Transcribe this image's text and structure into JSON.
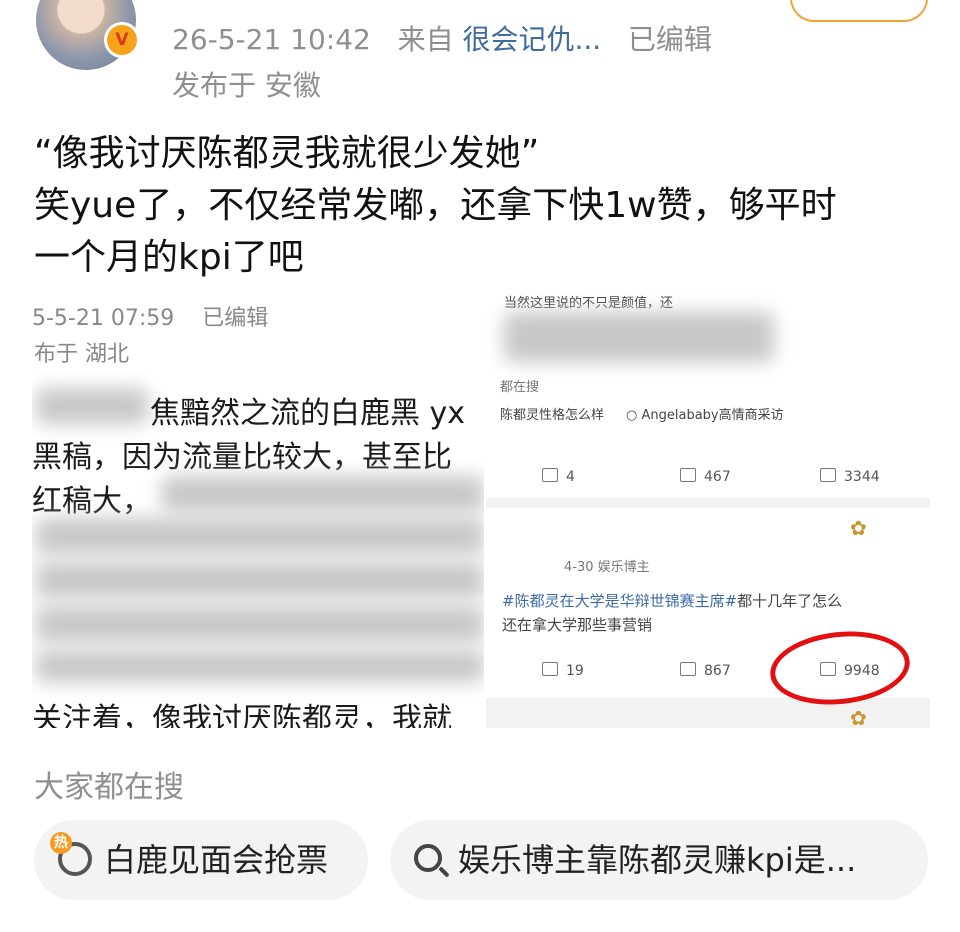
{
  "header": {
    "timestamp": "26-5-21 10:42",
    "from_label": "来自",
    "source": "很会记仇...",
    "edited": "已编辑",
    "location": "发布于 安徽"
  },
  "post": {
    "line1": "“像我讨厌陈都灵我就很少发她”",
    "line2": "笑yue了，不仅经常发嘟，还拿下快1w赞，够平时",
    "line3": "一个月的kpi了吧"
  },
  "embedded_left": {
    "timestamp": "5-5-21 07:59",
    "edited": "已编辑",
    "location": "布于 湖北",
    "line1": "焦黯然之流的白鹿黑 yx",
    "line2": "黑稿，因为流量比较大，甚至比",
    "line3": "红稿大，",
    "line4": "关注着，像我讨厌陈都灵，我就"
  },
  "embedded_right": {
    "top_text": "当然这里说的不只是颜值，还",
    "search_label": "都在搜",
    "search1": "陈都灵性格怎么样",
    "search2": "Angelababy高情商采访",
    "card1": {
      "reposts": "4",
      "comments": "467",
      "likes": "3344"
    },
    "card2": {
      "date": "4-30 娱乐博主",
      "hashtag": "#陈都灵在大学是华辩世锦赛主席#",
      "text1": "都十几年了怎么",
      "text2": "还在拿大学那些事营销",
      "reposts": "19",
      "comments": "867",
      "likes": "9948"
    }
  },
  "hot_search": {
    "label": "大家都在搜",
    "badge": "热",
    "item1": "白鹿见面会抢票",
    "item2": "娱乐博主靠陈都灵赚kpi是..."
  }
}
